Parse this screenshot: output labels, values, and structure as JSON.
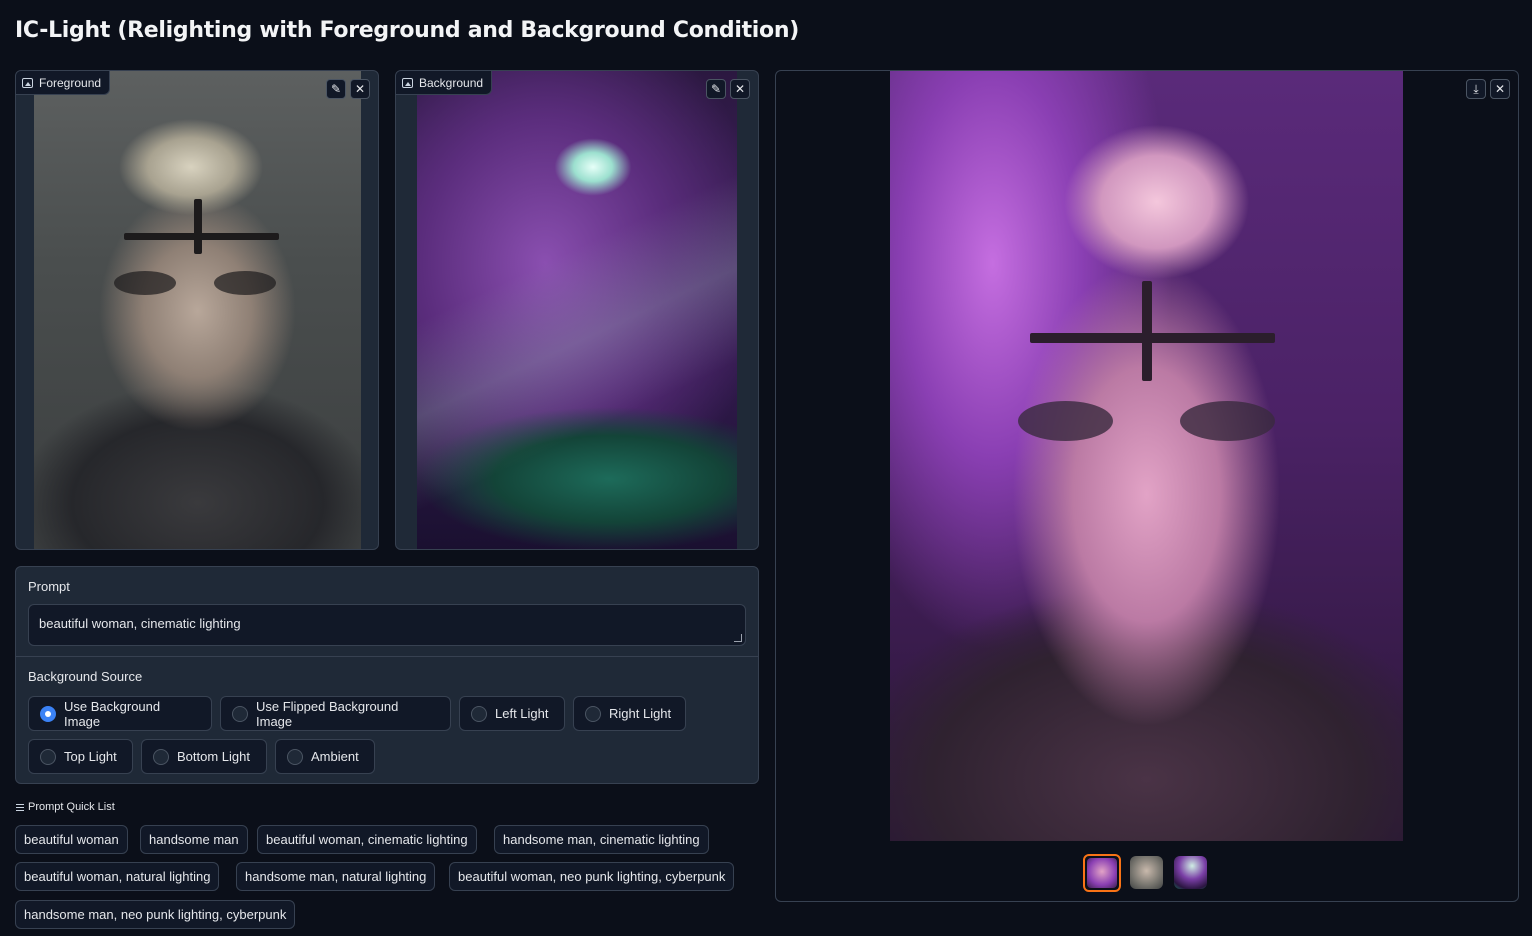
{
  "app": {
    "title": "IC-Light (Relighting with Foreground and Background Condition)"
  },
  "foreground": {
    "label": "Foreground",
    "edit_icon": "pencil-icon",
    "clear_icon": "close-icon"
  },
  "background": {
    "label": "Background",
    "edit_icon": "pencil-icon",
    "clear_icon": "close-icon"
  },
  "prompt": {
    "label": "Prompt",
    "value": "beautiful woman, cinematic lighting"
  },
  "bg_source": {
    "label": "Background Source",
    "options": [
      "Use Background Image",
      "Use Flipped Background Image",
      "Left Light",
      "Right Light",
      "Top Light",
      "Bottom Light",
      "Ambient"
    ],
    "selected": "Use Background Image"
  },
  "quick_list": {
    "label": "Prompt Quick List",
    "items": [
      "beautiful woman",
      "handsome man",
      "beautiful woman, cinematic lighting",
      "handsome man, cinematic lighting",
      "beautiful woman, natural lighting",
      "handsome man, natural lighting",
      "beautiful woman, neo punk lighting, cyberpunk",
      "handsome man, neo punk lighting, cyberpunk"
    ]
  },
  "result": {
    "download_icon": "download-icon",
    "clear_icon": "close-icon",
    "selected_thumb": 0
  },
  "colors": {
    "accent": "#3b82f6",
    "thumb_highlight": "#f97316",
    "page_bg": "#0b0f19",
    "panel_bg": "#1f2937"
  }
}
